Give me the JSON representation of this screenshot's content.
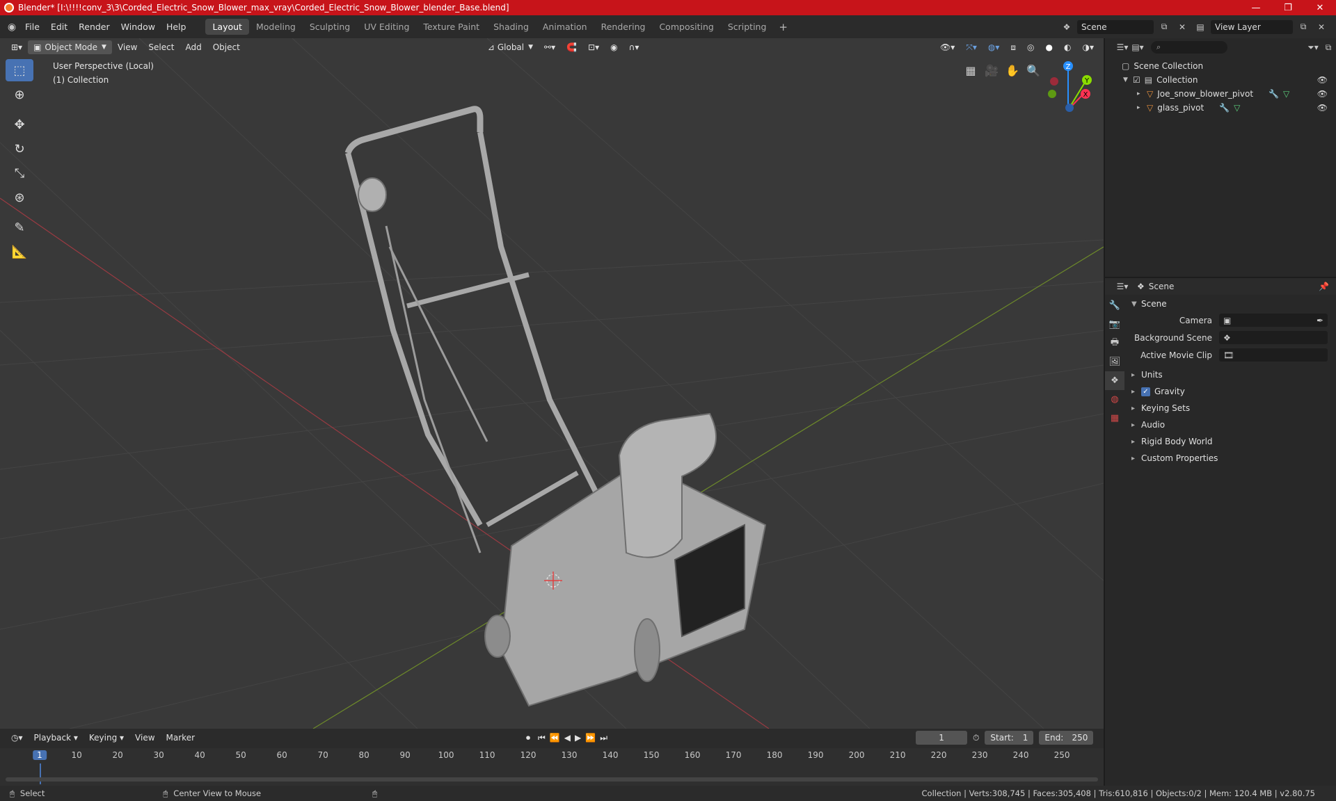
{
  "window": {
    "title": "Blender* [I:\\!!!!conv_3\\3\\Corded_Electric_Snow_Blower_max_vray\\Corded_Electric_Snow_Blower_blender_Base.blend]",
    "minimize": "—",
    "maximize": "❐",
    "close": "✕"
  },
  "menubar": {
    "items": [
      "File",
      "Edit",
      "Render",
      "Window",
      "Help"
    ],
    "workspaces": [
      "Layout",
      "Modeling",
      "Sculpting",
      "UV Editing",
      "Texture Paint",
      "Shading",
      "Animation",
      "Rendering",
      "Compositing",
      "Scripting"
    ],
    "active_workspace": "Layout",
    "add_tab": "+",
    "scene": "Scene",
    "view_layer": "View Layer"
  },
  "viewport": {
    "mode": "Object Mode",
    "menus": [
      "View",
      "Select",
      "Add",
      "Object"
    ],
    "orientation": "Global",
    "info_line1": "User Perspective (Local)",
    "info_line2": "(1) Collection",
    "gizmo_labels": {
      "x": "X",
      "y": "Y",
      "z": "Z"
    }
  },
  "timeline": {
    "menus": [
      "Playback",
      "Keying",
      "View",
      "Marker"
    ],
    "current_frame": "1",
    "start_label": "Start:",
    "start": "1",
    "end_label": "End:",
    "end": "250",
    "ticks": [
      "1",
      "10",
      "20",
      "30",
      "40",
      "50",
      "60",
      "70",
      "80",
      "90",
      "100",
      "110",
      "120",
      "130",
      "140",
      "150",
      "160",
      "170",
      "180",
      "190",
      "200",
      "210",
      "220",
      "230",
      "240",
      "250"
    ]
  },
  "statusbar": {
    "left_action": "Select",
    "mid_action": "Center View to Mouse",
    "stats": "Collection | Verts:308,745 | Faces:305,408 | Tris:610,816 | Objects:0/2 | Mem: 120.4 MB | v2.80.75"
  },
  "outliner": {
    "root": "Scene Collection",
    "collection": "Collection",
    "objects": [
      "Joe_snow_blower_pivot",
      "glass_pivot"
    ]
  },
  "properties": {
    "header": "Scene",
    "panel": "Scene",
    "camera_label": "Camera",
    "background_scene_label": "Background Scene",
    "active_movie_clip_label": "Active Movie Clip",
    "subpanels": [
      "Units",
      "Gravity",
      "Keying Sets",
      "Audio",
      "Rigid Body World",
      "Custom Properties"
    ]
  },
  "colors": {
    "titlebar": "#c7141a",
    "accent": "#4772b3",
    "viewport_bg": "#393939",
    "x_axis": "#ff3352",
    "y_axis": "#8bdc00",
    "z_axis": "#2890ff"
  }
}
